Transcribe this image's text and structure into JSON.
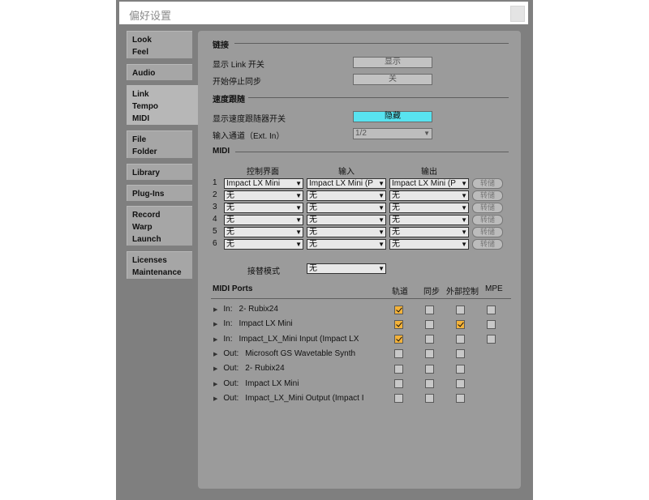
{
  "window": {
    "title": "偏好设置"
  },
  "tabs": [
    {
      "lines": [
        "Look",
        "Feel"
      ]
    },
    {
      "lines": [
        "Audio"
      ]
    },
    {
      "lines": [
        "Link",
        "Tempo",
        "MIDI"
      ]
    },
    {
      "lines": [
        "File",
        "Folder"
      ]
    },
    {
      "lines": [
        "Library"
      ]
    },
    {
      "lines": [
        "Plug-Ins"
      ]
    },
    {
      "lines": [
        "Record",
        "Warp",
        "Launch"
      ]
    },
    {
      "lines": [
        "Licenses",
        "Maintenance"
      ]
    }
  ],
  "link": {
    "heading": "链接",
    "show_label": "显示 Link 开关",
    "show_value": "显示",
    "sync_label": "开始停止同步",
    "sync_value": "关"
  },
  "tempo": {
    "heading": "速度跟随",
    "show_label": "显示速度跟随器开关",
    "show_value": "隐藏",
    "input_label": "输入通道（Ext. In）",
    "input_value": "1/2"
  },
  "midi": {
    "heading": "MIDI",
    "col_control": "控制界面",
    "col_input": "输入",
    "col_output": "输出",
    "rows": [
      {
        "num": "1",
        "control": "Impact LX Mini",
        "input": "Impact LX Mini (P",
        "output": "Impact LX Mini (P",
        "dump": "转储"
      },
      {
        "num": "2",
        "control": "无",
        "input": "无",
        "output": "无",
        "dump": "转储"
      },
      {
        "num": "3",
        "control": "无",
        "input": "无",
        "output": "无",
        "dump": "转储"
      },
      {
        "num": "4",
        "control": "无",
        "input": "无",
        "output": "无",
        "dump": "转储"
      },
      {
        "num": "5",
        "control": "无",
        "input": "无",
        "output": "无",
        "dump": "转储"
      },
      {
        "num": "6",
        "control": "无",
        "input": "无",
        "output": "无",
        "dump": "转储"
      }
    ],
    "takeover_label": "接替模式",
    "takeover_value": "无"
  },
  "ports": {
    "heading": "MIDI Ports",
    "col_track": "轨道",
    "col_sync": "同步",
    "col_remote": "外部控制",
    "col_mpe": "MPE",
    "rows": [
      {
        "dir": "In:",
        "name": "2- Rubix24",
        "track": true,
        "sync": false,
        "remote": false,
        "mpe": false
      },
      {
        "dir": "In:",
        "name": "Impact LX Mini",
        "track": true,
        "sync": false,
        "remote": true,
        "mpe": false
      },
      {
        "dir": "In:",
        "name": "Impact_LX_Mini Input (Impact LX",
        "track": true,
        "sync": false,
        "remote": false,
        "mpe": false
      },
      {
        "dir": "Out:",
        "name": "Microsoft GS Wavetable Synth",
        "track": false,
        "sync": false,
        "remote": false
      },
      {
        "dir": "Out:",
        "name": "2- Rubix24",
        "track": false,
        "sync": false,
        "remote": false
      },
      {
        "dir": "Out:",
        "name": "Impact LX Mini",
        "track": false,
        "sync": false,
        "remote": false
      },
      {
        "dir": "Out:",
        "name": "Impact_LX_Mini Output (Impact I",
        "track": false,
        "sync": false,
        "remote": false
      }
    ]
  },
  "colors": {
    "accent_active": "#58e3f0",
    "checkbox_on": "#f3b23a"
  }
}
